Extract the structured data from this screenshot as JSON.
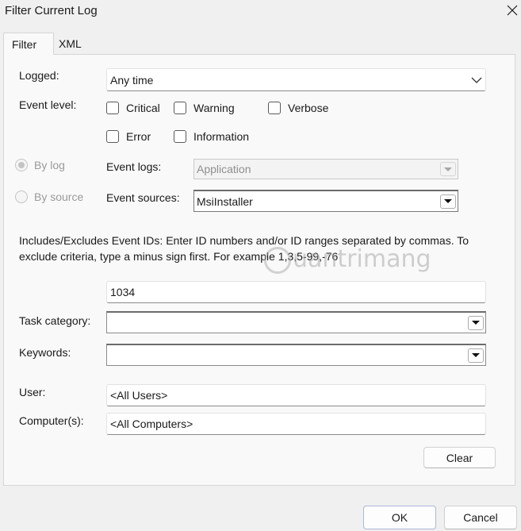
{
  "window": {
    "title": "Filter Current Log",
    "close_icon": "close-icon"
  },
  "tabs": [
    {
      "label": "Filter",
      "active": true
    },
    {
      "label": "XML",
      "active": false
    }
  ],
  "logged": {
    "label": "Logged:",
    "value": "Any time"
  },
  "event_level": {
    "label": "Event level:",
    "options": [
      "Critical",
      "Warning",
      "Verbose",
      "Error",
      "Information"
    ]
  },
  "source_mode": {
    "by_log": "By log",
    "by_source": "By source"
  },
  "event_logs": {
    "label": "Event logs:",
    "value": "Application"
  },
  "event_sources": {
    "label": "Event sources:",
    "value": "MsiInstaller"
  },
  "ids": {
    "description": "Includes/Excludes Event IDs: Enter ID numbers and/or ID ranges separated by commas. To exclude criteria, type a minus sign first. For example 1,3,5-99,-76",
    "value": "1034"
  },
  "task_category": {
    "label": "Task category:",
    "value": ""
  },
  "keywords": {
    "label": "Keywords:",
    "value": ""
  },
  "user": {
    "label": "User:",
    "value": "<All Users>"
  },
  "computers": {
    "label": "Computer(s):",
    "value": "<All Computers>"
  },
  "buttons": {
    "clear": "Clear",
    "ok": "OK",
    "cancel": "Cancel"
  },
  "watermark": "uantrimang"
}
